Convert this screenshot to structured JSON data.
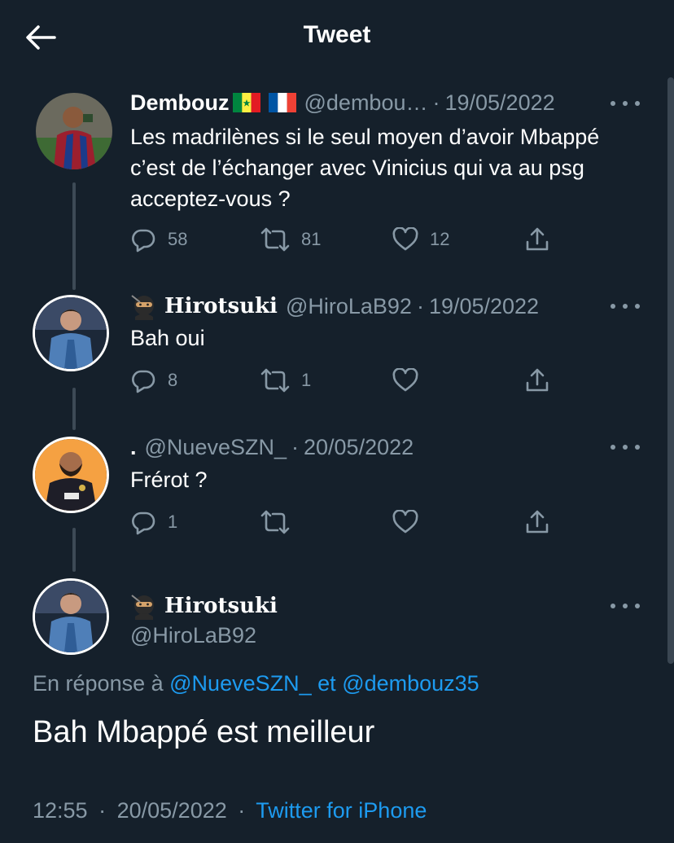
{
  "header": {
    "title": "Tweet"
  },
  "tweets": [
    {
      "name": "Dembouz",
      "handle": "@dembou…",
      "date": "19/05/2022",
      "text": "Les madrilènes si le seul moyen d’avoir Mbappé c’est de l’échanger avec Vinicius qui va au psg acceptez-vous ?",
      "replies": "58",
      "retweets": "81",
      "likes": "12",
      "flags": [
        "senegal-flag",
        "france-flag"
      ]
    },
    {
      "name": "Hirotsuki",
      "handle": "@HiroLaB92",
      "date": "19/05/2022",
      "text": "Bah oui",
      "replies": "8",
      "retweets": "1",
      "likes": ""
    },
    {
      "name": ".",
      "handle": "@NueveSZN_",
      "date": "20/05/2022",
      "text": "Frérot ?",
      "replies": "1",
      "retweets": "",
      "likes": ""
    }
  ],
  "main_tweet": {
    "name": "Hirotsuki",
    "handle": "@HiroLaB92",
    "reply_prefix": "En réponse à",
    "reply_user1": "@NueveSZN_",
    "reply_and": "et",
    "reply_user2": "@dembouz35",
    "text": "Bah Mbappé est meilleur",
    "time": "12:55",
    "date": "20/05/2022",
    "source": "Twitter for iPhone"
  },
  "colors": {
    "background": "#15202b",
    "secondary_text": "#8899a6",
    "link": "#1d9bf0"
  },
  "icons": [
    "back-arrow-icon",
    "reply-icon",
    "retweet-icon",
    "like-icon",
    "share-icon",
    "more-icon",
    "ninja-emoji-icon"
  ]
}
